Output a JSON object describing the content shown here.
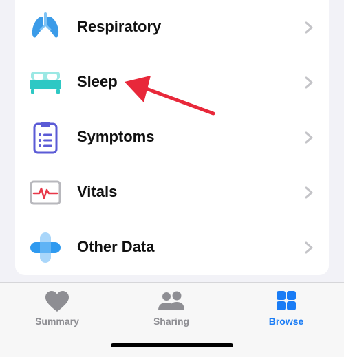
{
  "list": {
    "items": [
      {
        "label": "Respiratory",
        "icon": "lungs-icon",
        "color": "#3b9be8"
      },
      {
        "label": "Sleep",
        "icon": "bed-icon",
        "color": "#2ec8c4"
      },
      {
        "label": "Symptoms",
        "icon": "clipboard-icon",
        "color": "#5b5bd6"
      },
      {
        "label": "Vitals",
        "icon": "vitals-monitor-icon",
        "color": "#e8394a"
      },
      {
        "label": "Other Data",
        "icon": "plus-icon",
        "color": "#2f9af0"
      }
    ]
  },
  "annotation": {
    "arrow_color": "#e8283a",
    "points_to": "Sleep"
  },
  "tabbar": {
    "tabs": [
      {
        "label": "Summary",
        "icon": "heart-icon",
        "active": false
      },
      {
        "label": "Sharing",
        "icon": "people-icon",
        "active": false
      },
      {
        "label": "Browse",
        "icon": "grid-icon",
        "active": true
      }
    ],
    "active_color": "#1a7cf5",
    "inactive_color": "#8e8e93"
  }
}
